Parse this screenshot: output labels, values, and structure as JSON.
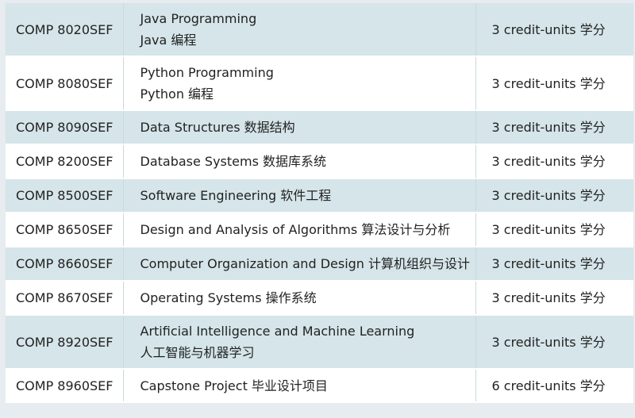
{
  "courses": [
    {
      "code": "COMP 8020SEF",
      "title_en": "Java Programming",
      "title_zh": "Java 编程",
      "credits": "3 credit-units 学分"
    },
    {
      "code": "COMP 8080SEF",
      "title_en": "Python Programming",
      "title_zh": "Python 编程",
      "credits": "3 credit-units 学分"
    },
    {
      "code": "COMP 8090SEF",
      "title": "Data Structures 数据结构",
      "credits": "3 credit-units 学分"
    },
    {
      "code": "COMP 8200SEF",
      "title": "Database Systems 数据库系统",
      "credits": "3 credit-units 学分"
    },
    {
      "code": "COMP 8500SEF",
      "title": "Software Engineering 软件工程",
      "credits": "3 credit-units 学分"
    },
    {
      "code": "COMP 8650SEF",
      "title": "Design and Analysis of Algorithms 算法设计与分析",
      "credits": "3 credit-units 学分"
    },
    {
      "code": "COMP 8660SEF",
      "title": "Computer Organization and Design 计算机组织与设计",
      "credits": "3 credit-units 学分"
    },
    {
      "code": "COMP 8670SEF",
      "title": "Operating Systems 操作系统",
      "credits": "3 credit-units 学分"
    },
    {
      "code": "COMP 8920SEF",
      "title_en": "Artificial Intelligence and Machine Learning",
      "title_zh": "人工智能与机器学习",
      "credits": "3 credit-units 学分"
    },
    {
      "code": "COMP 8960SEF",
      "title": "Capstone Project 毕业设计项目",
      "credits": "6 credit-units 学分"
    }
  ]
}
